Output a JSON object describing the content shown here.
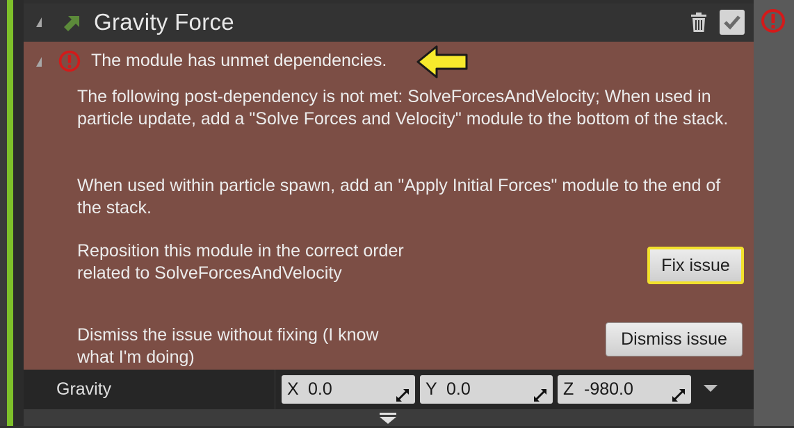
{
  "header": {
    "title": "Gravity Force",
    "module_icon": "green-arrow-icon",
    "delete_icon": "trash-icon",
    "enabled_icon": "checkmark-icon",
    "enabled": true
  },
  "status": {
    "icon": "error-alert-icon",
    "color": "#d31a1a"
  },
  "issue": {
    "title": "The module has unmet dependencies.",
    "pointer_icon": "yellow-arrow-icon",
    "paragraph1": "The following post-dependency is not met: SolveForcesAndVelocity; When used in particle update, add a \"Solve Forces and Velocity\" module to the bottom of the stack.",
    "paragraph2": "When used within particle spawn, add an \"Apply Initial Forces\" module to the end of the stack.",
    "fix_description": "Reposition this module in the correct order related to SolveForcesAndVelocity",
    "fix_button": "Fix issue",
    "dismiss_description": "Dismiss the issue without fixing (I know what I'm doing)",
    "dismiss_button": "Dismiss issue"
  },
  "gravity": {
    "label": "Gravity",
    "x_axis": "X",
    "x_value": "0.0",
    "y_axis": "Y",
    "y_value": "0.0",
    "z_axis": "Z",
    "z_value": "-980.0"
  },
  "colors": {
    "accent_green": "#7ec02a",
    "issue_background": "#7c4e45",
    "highlight_yellow": "#f2e12d",
    "error_red": "#d31a1a"
  }
}
